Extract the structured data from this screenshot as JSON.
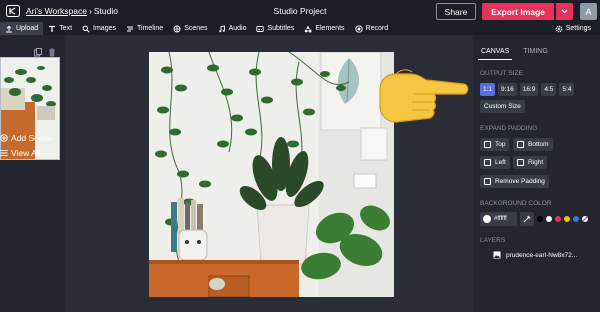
{
  "header": {
    "workspace": "Ari's Workspace",
    "separator": "›",
    "section": "Studio",
    "project_title": "Studio Project",
    "share_label": "Share",
    "export_label": "Export Image",
    "avatar_initial": "A"
  },
  "toolbar": {
    "items": [
      {
        "label": "Upload",
        "icon": "upload-icon"
      },
      {
        "label": "Text",
        "icon": "text-icon"
      },
      {
        "label": "Images",
        "icon": "search-icon"
      },
      {
        "label": "Timeline",
        "icon": "timeline-icon"
      },
      {
        "label": "Scenes",
        "icon": "scenes-icon"
      },
      {
        "label": "Audio",
        "icon": "audio-icon"
      },
      {
        "label": "Subtitles",
        "icon": "subtitles-icon"
      },
      {
        "label": "Elements",
        "icon": "elements-icon"
      },
      {
        "label": "Record",
        "icon": "record-icon"
      }
    ],
    "settings_label": "Settings"
  },
  "left_panel": {
    "add_scene_label": "Add Scene",
    "view_all_label": "View All"
  },
  "right_panel": {
    "tabs": [
      "CANVAS",
      "TIMING"
    ],
    "output_size_title": "OUTPUT SIZE",
    "ratios": [
      "1:1",
      "9:16",
      "16:9",
      "4:5",
      "5:4"
    ],
    "selected_ratio": "1:1",
    "custom_size_label": "Custom Size",
    "expand_padding_title": "EXPAND PADDING",
    "padding": {
      "top": "Top",
      "bottom": "Bottom",
      "left": "Left",
      "right": "Right",
      "remove": "Remove Padding"
    },
    "background_color_title": "BACKGROUND COLOR",
    "background_hex": "#ffffff",
    "swatch_colors": [
      "#000000",
      "#ffffff",
      "#e8325a",
      "#f2c200",
      "#2f7de1"
    ],
    "layers_title": "LAYERS",
    "layer_name": "prudence-earl-Nw8x72..."
  },
  "colors": {
    "accent": "#e8325a",
    "selected": "#5b6ee1",
    "panel": "#23262f",
    "stage": "#2a2d36"
  }
}
